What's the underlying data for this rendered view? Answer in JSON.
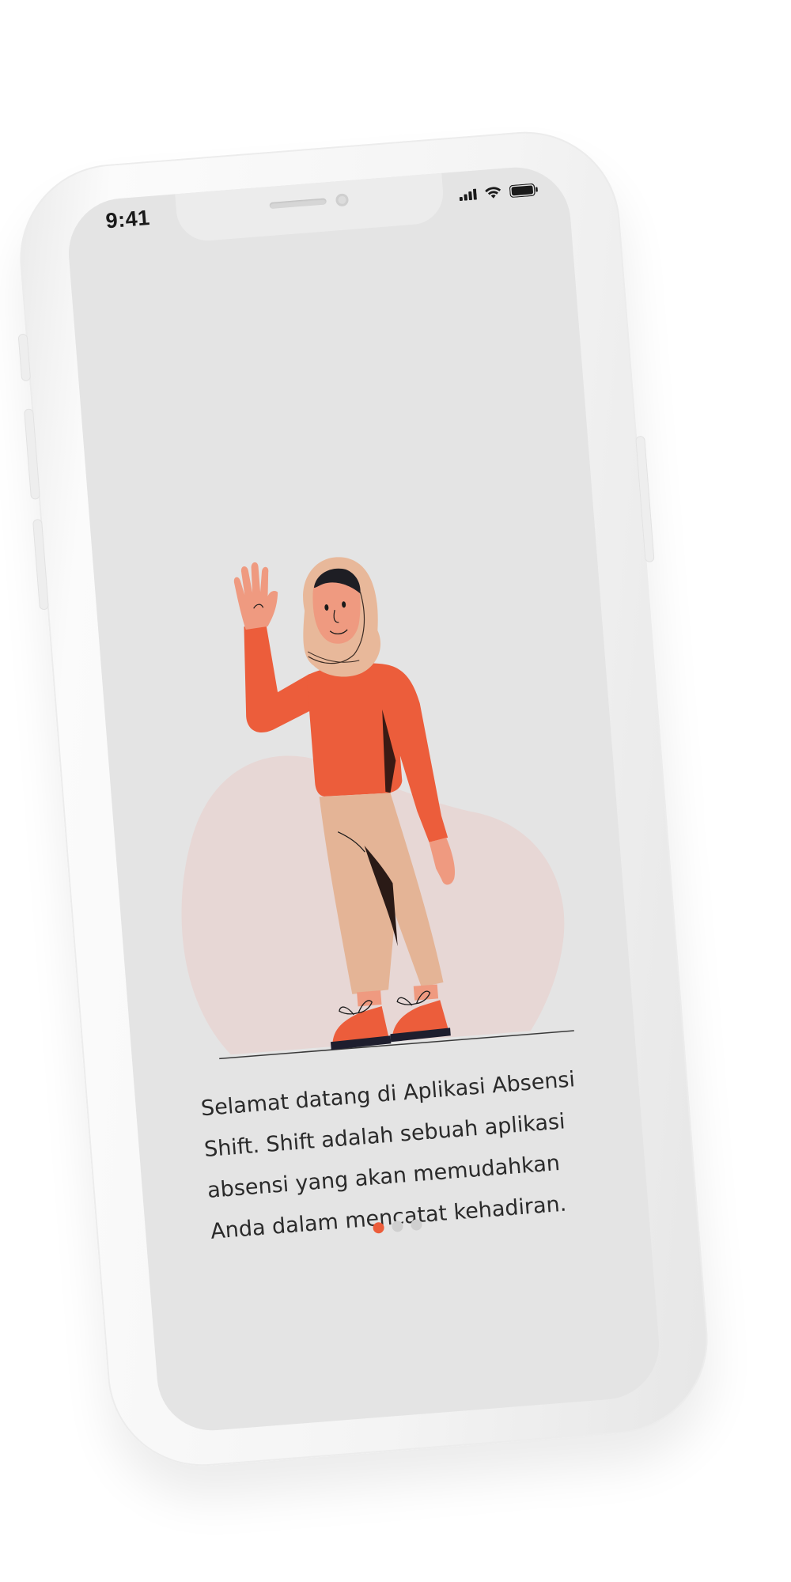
{
  "status_bar": {
    "time": "9:41"
  },
  "onboarding": {
    "description": "Selamat datang di Aplikasi Absensi Shift. Shift adalah sebuah aplikasi absensi yang akan memudahkan Anda dalam mencatat kehadiran.",
    "pagination": {
      "total": 3,
      "active_index": 0
    }
  },
  "colors": {
    "accent": "#ec5d3b",
    "screen_background": "#e4e4e4",
    "blob": "#e7d7d5",
    "skin": "#ef9a80",
    "pants": "#e4b496",
    "hijab": "#e8b89a",
    "inactive_dot": "#cfcfcf"
  },
  "icons": [
    "signal-icon",
    "wifi-icon",
    "battery-icon"
  ]
}
